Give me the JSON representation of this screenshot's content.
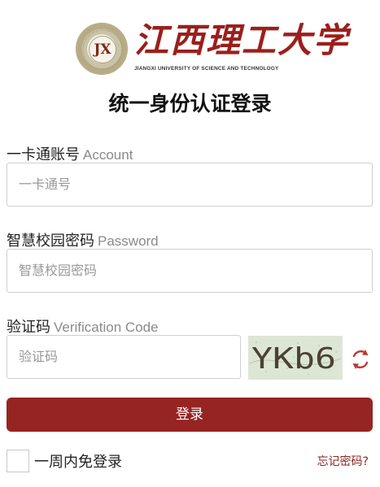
{
  "header": {
    "seal_glyph": "JX",
    "logo_cn": "江西理工大学",
    "logo_en": "JIANGXI UNIVERSITY OF SCIENCE AND TECHNOLOGY"
  },
  "title": "统一身份认证登录",
  "account": {
    "label": "一卡通账号",
    "label_en": "Account",
    "placeholder": "一卡通号"
  },
  "password": {
    "label": "智慧校园密码",
    "label_en": "Password",
    "placeholder": "智慧校园密码"
  },
  "verification": {
    "label": "验证码",
    "label_en": "Verification Code",
    "placeholder": "验证码",
    "captcha_text": "YKb6",
    "refresh_icon": "refresh-icon"
  },
  "login_button": "登录",
  "remember_label": "一周内免登录",
  "forgot_link": "忘记密码?",
  "colors": {
    "brand": "#962422",
    "logo_red": "#9b1f1c",
    "link": "#8a2622"
  }
}
